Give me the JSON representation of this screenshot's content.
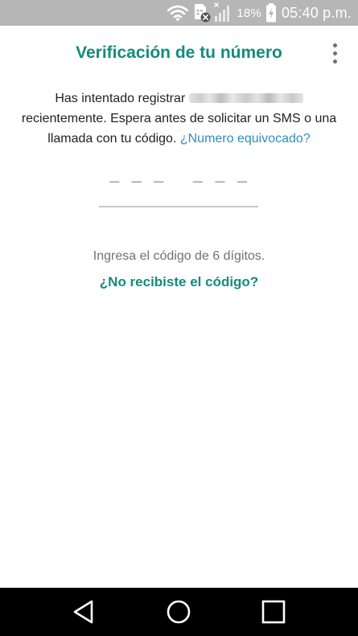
{
  "status_bar": {
    "battery_percent": "18%",
    "time": "05:40 p.m.",
    "icons": [
      "wifi-icon",
      "sim-no-service-icon",
      "cell-signal-icon",
      "battery-charging-icon"
    ]
  },
  "header": {
    "title": "Verificación de tu número",
    "menu_icon": "more-vert-icon"
  },
  "message": {
    "part1": "Has intentado registrar",
    "part2": "recientemente. Espera antes de solicitar un SMS o una llamada con tu código.",
    "wrong_number_link": "¿Numero equivocado?"
  },
  "code_input": {
    "placeholder": "–  –  –     –  –  –"
  },
  "hint": "Ingresa el código de 6 dígitos.",
  "resend_link": "¿No recibiste el código?",
  "nav_bar": {
    "icons": [
      "back-icon",
      "home-icon",
      "recents-icon"
    ]
  },
  "colors": {
    "accent": "#128c7e",
    "link": "#2f8ec0",
    "status_bar": "#b6b6b6",
    "nav_bar": "#000000"
  }
}
